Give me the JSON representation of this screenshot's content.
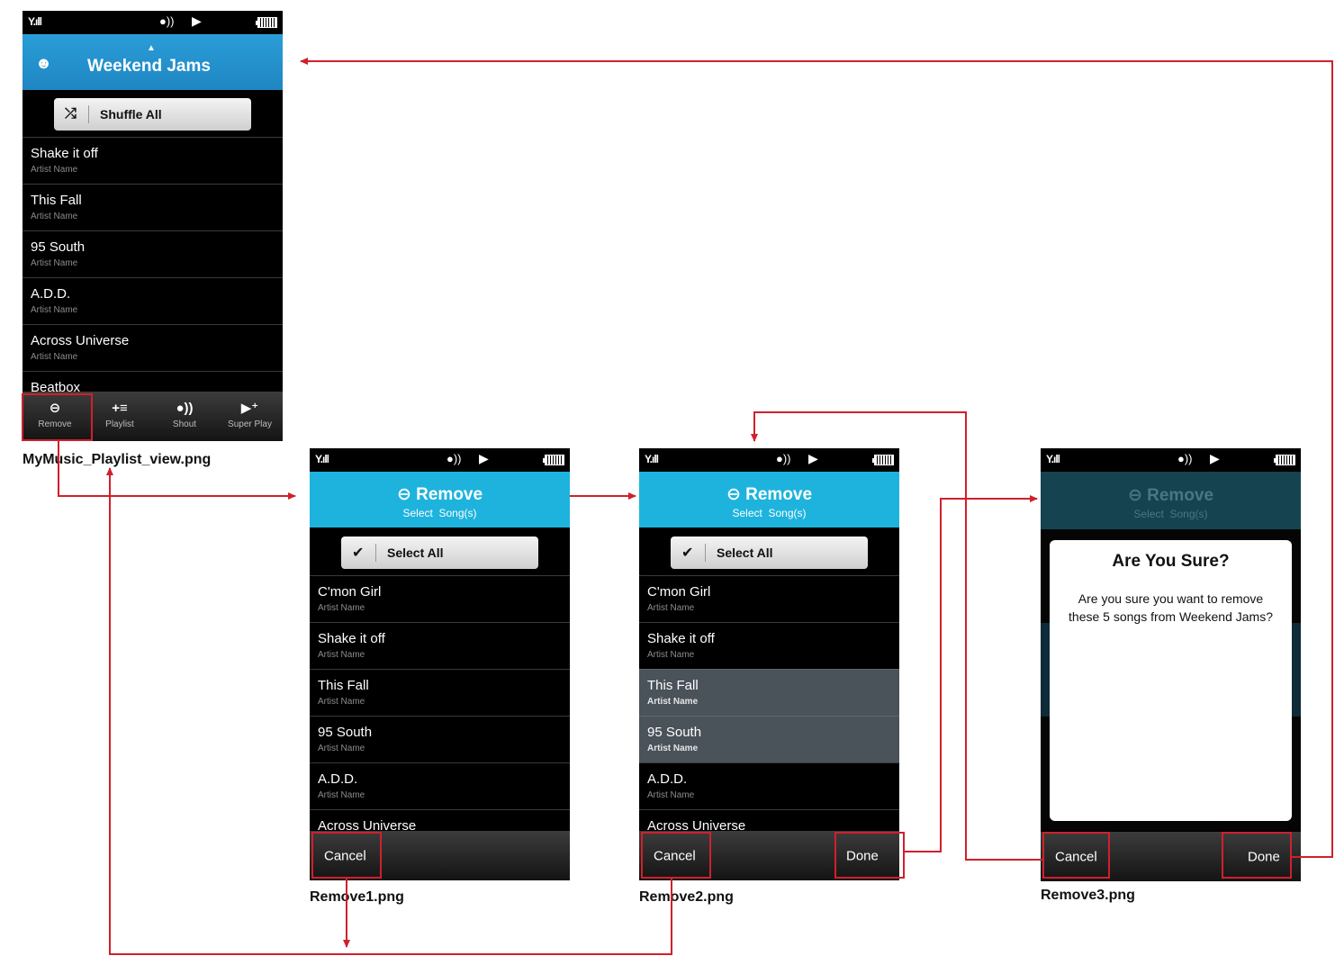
{
  "screens": {
    "playlist": {
      "caption": "MyMusic_Playlist_view.png",
      "title": "Weekend Jams",
      "shuffle_label": "Shuffle All",
      "songs": [
        {
          "title": "Shake it off",
          "artist": "Artist Name"
        },
        {
          "title": "This Fall",
          "artist": "Artist Name"
        },
        {
          "title": "95 South",
          "artist": "Artist Name"
        },
        {
          "title": "A.D.D.",
          "artist": "Artist Name"
        },
        {
          "title": "Across Universe",
          "artist": "Artist Name"
        },
        {
          "title": "Beatbox",
          "artist": ""
        }
      ],
      "toolbar": [
        {
          "icon": "remove-icon",
          "label": "Remove"
        },
        {
          "icon": "add-playlist-icon",
          "label": "Playlist"
        },
        {
          "icon": "shout-icon",
          "label": "Shout"
        },
        {
          "icon": "super-play-icon",
          "label": "Super Play"
        }
      ]
    },
    "remove1": {
      "caption": "Remove1.png",
      "title": "Remove",
      "subtitle": "Select  Song(s)",
      "select_all_label": "Select All",
      "songs": [
        {
          "title": "C'mon Girl",
          "artist": "Artist Name"
        },
        {
          "title": "Shake it off",
          "artist": "Artist Name"
        },
        {
          "title": "This Fall",
          "artist": "Artist Name"
        },
        {
          "title": "95 South",
          "artist": "Artist Name"
        },
        {
          "title": "A.D.D.",
          "artist": "Artist Name"
        },
        {
          "title": "Across Universe",
          "artist": ""
        }
      ],
      "cancel_label": "Cancel"
    },
    "remove2": {
      "caption": "Remove2.png",
      "title": "Remove",
      "subtitle": "Select  Song(s)",
      "select_all_label": "Select All",
      "songs": [
        {
          "title": "C'mon Girl",
          "artist": "Artist Name",
          "selected": false
        },
        {
          "title": "Shake it off",
          "artist": "Artist Name",
          "selected": false
        },
        {
          "title": "This Fall",
          "artist": "Artist Name",
          "selected": true
        },
        {
          "title": "95 South",
          "artist": "Artist Name",
          "selected": true
        },
        {
          "title": "A.D.D.",
          "artist": "Artist Name",
          "selected": false
        },
        {
          "title": "Across Universe",
          "artist": "",
          "selected": false
        }
      ],
      "cancel_label": "Cancel",
      "done_label": "Done"
    },
    "remove3": {
      "caption": "Remove3.png",
      "title": "Remove",
      "subtitle": "Select  Song(s)",
      "dialog_title": "Are You Sure?",
      "dialog_message": "Are you sure you want to remove these 5 songs from Weekend Jams?",
      "cancel_label": "Cancel",
      "done_label": "Done"
    }
  },
  "colors": {
    "flow_arrow": "#d0202c",
    "header_blue": "#2a9dd8",
    "header_cyan": "#1eb3dd",
    "selected_row": "#4a525a"
  }
}
